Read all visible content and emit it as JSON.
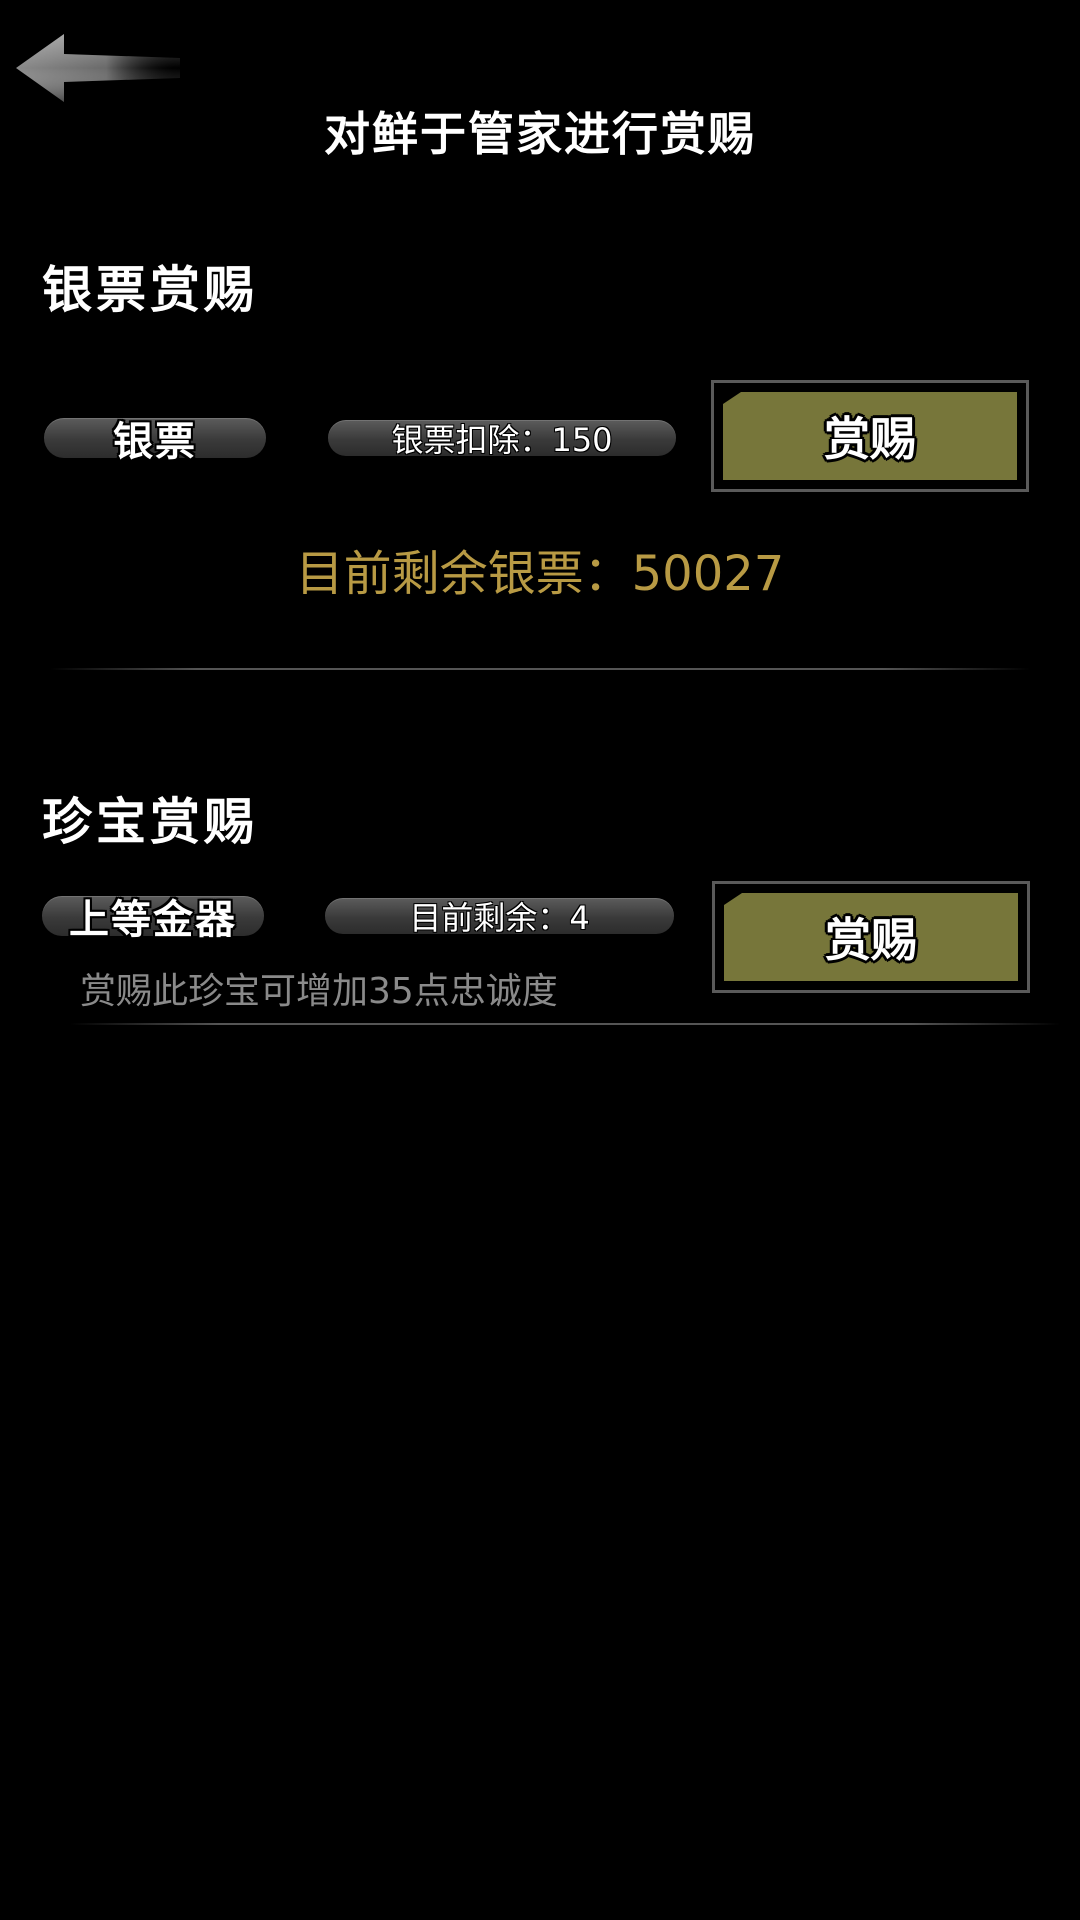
{
  "page": {
    "title": "对鲜于管家进行赏赐"
  },
  "silver_section": {
    "title": "银票赏赐",
    "item_name": "银票",
    "deduction_label": "银票扣除：150",
    "reward_button": "赏赐",
    "remaining_label": "目前剩余银票：50027"
  },
  "treasure_section": {
    "title": "珍宝赏赐",
    "item_name": "上等金器",
    "remaining_label": "目前剩余：4",
    "reward_button": "赏赐",
    "description": "赏赐此珍宝可增加35点忠诚度"
  },
  "colors": {
    "background": "#000000",
    "button_face": "#77763a",
    "gold_text": "#b89a44",
    "muted_text": "#8a8a8a"
  },
  "icons": {
    "back": "back-arrow-icon"
  }
}
